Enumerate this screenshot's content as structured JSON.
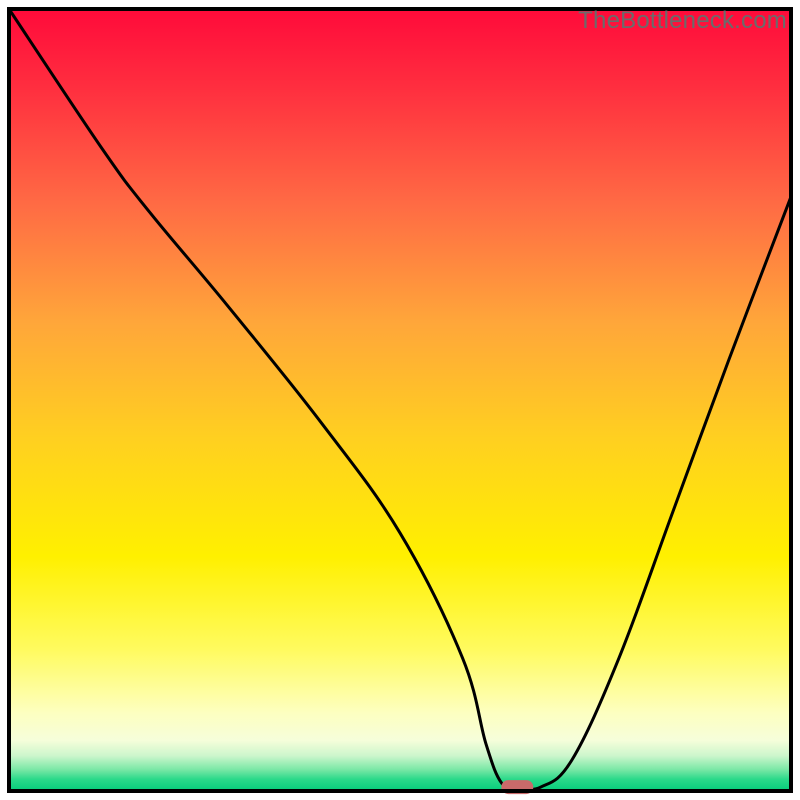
{
  "watermark": "TheBottleneck.com",
  "chart_data": {
    "type": "line",
    "title": "",
    "xlabel": "",
    "ylabel": "",
    "xlim": [
      0,
      100
    ],
    "ylim": [
      0,
      100
    ],
    "series": [
      {
        "name": "bottleneck-curve",
        "x": [
          0,
          12,
          18,
          28,
          40,
          50,
          58,
          61,
          63,
          65,
          68,
          72,
          78,
          85,
          92,
          100
        ],
        "values": [
          100,
          82,
          74,
          62,
          47,
          33,
          17,
          6,
          1,
          0.5,
          0.5,
          4,
          17,
          36,
          55,
          76
        ]
      }
    ],
    "marker": {
      "x": 65,
      "y": 0.5,
      "color": "#c96a6a"
    },
    "background": {
      "type": "vertical-gradient",
      "stops": [
        {
          "pos": 0.0,
          "color": "#ff0a3a"
        },
        {
          "pos": 0.1,
          "color": "#ff2e3f"
        },
        {
          "pos": 0.25,
          "color": "#ff6b44"
        },
        {
          "pos": 0.4,
          "color": "#ffa63a"
        },
        {
          "pos": 0.55,
          "color": "#ffd020"
        },
        {
          "pos": 0.7,
          "color": "#fff000"
        },
        {
          "pos": 0.82,
          "color": "#fffb60"
        },
        {
          "pos": 0.9,
          "color": "#fdffc0"
        },
        {
          "pos": 0.935,
          "color": "#f6feda"
        },
        {
          "pos": 0.955,
          "color": "#ccf6cc"
        },
        {
          "pos": 0.972,
          "color": "#7de8a7"
        },
        {
          "pos": 0.985,
          "color": "#2bd98a"
        },
        {
          "pos": 1.0,
          "color": "#05cd7b"
        }
      ]
    },
    "border_color": "#000000"
  }
}
